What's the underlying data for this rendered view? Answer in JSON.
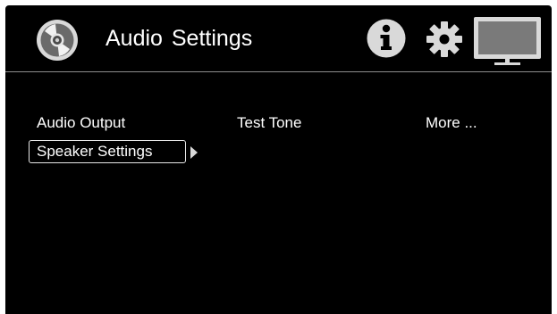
{
  "header": {
    "title": "Audio  Settings",
    "icons": [
      "disc-icon",
      "info-icon",
      "gear-icon",
      "tv-icon"
    ]
  },
  "menu": {
    "items": [
      {
        "label": "Audio Output"
      },
      {
        "label": "Test Tone"
      },
      {
        "label": "More ..."
      },
      {
        "label": "Speaker Settings",
        "selected": true
      }
    ]
  },
  "colors": {
    "background": "#000000",
    "text": "#ffffff",
    "divider": "#8f8f8f",
    "icon": "#d9d9d9",
    "tv_screen": "#7a7a7a"
  }
}
